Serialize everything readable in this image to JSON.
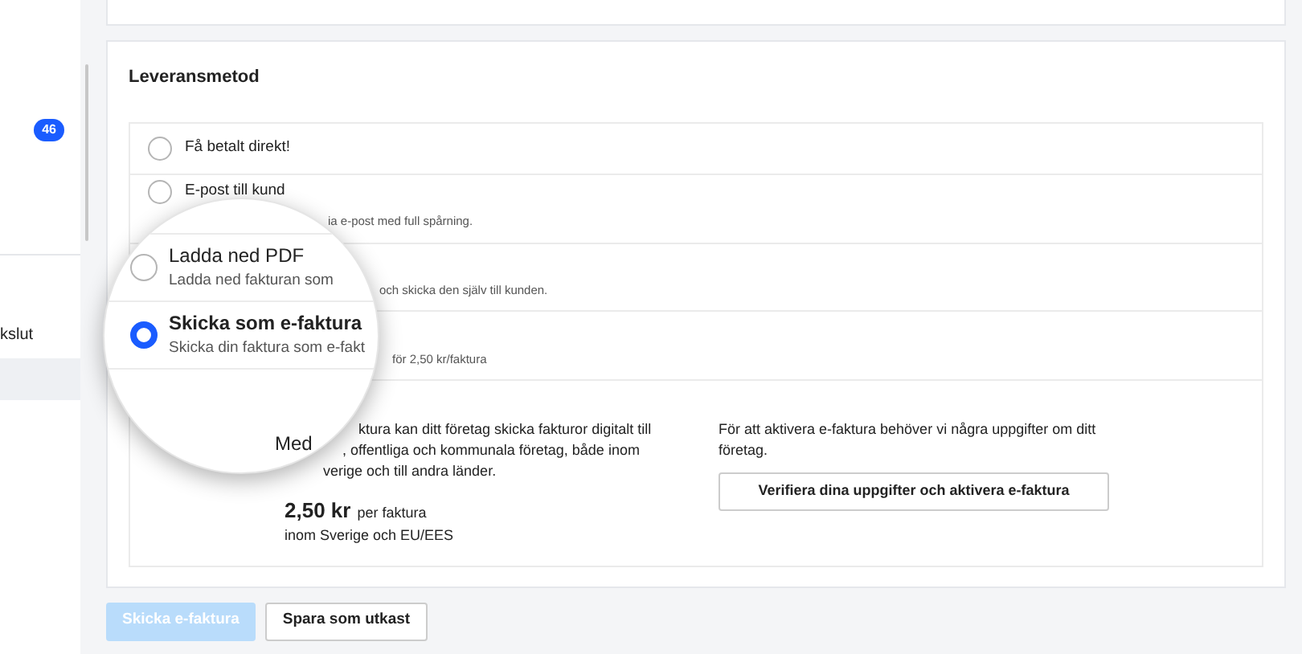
{
  "sidebar": {
    "badge": "46",
    "items": [
      {
        "label": "kslut",
        "selected": false
      },
      {
        "selected": true
      }
    ]
  },
  "delivery": {
    "title": "Leveransmetod",
    "options": [
      {
        "title": "Få betalt direkt!",
        "selected": false
      },
      {
        "title": "E-post till kund",
        "subtitle": "ia e-post med full spårning.",
        "selected": false
      },
      {
        "subtitle": "och skicka den själv till kunden."
      },
      {
        "subtitle": "för 2,50 kr/faktura"
      }
    ],
    "details": {
      "lines": [
        "ktura kan ditt företag skicka fakturor digitalt till",
        ", offentliga och kommunala företag, både inom",
        "verige och till andra länder."
      ],
      "price": "2,50 kr",
      "price_unit": "per faktura",
      "price_note": "inom Sverige och EU/EES",
      "info": "För att aktivera e-faktura behöver vi några uppgifter om ditt företag.",
      "verify_button": "Verifiera dina uppgifter och aktivera e-faktura"
    }
  },
  "magnifier": {
    "options": [
      {
        "title": "Ladda ned PDF",
        "subtitle": "Ladda ned fakturan som",
        "selected": false
      },
      {
        "title": "Skicka som e-faktura",
        "subtitle": "Skicka din faktura som e-fakt",
        "selected": true
      }
    ],
    "fragment": "Med"
  },
  "buttons": [
    {
      "label": "Skicka e-faktura",
      "disabled": true
    },
    {
      "label": "Spara som utkast",
      "disabled": false
    }
  ]
}
